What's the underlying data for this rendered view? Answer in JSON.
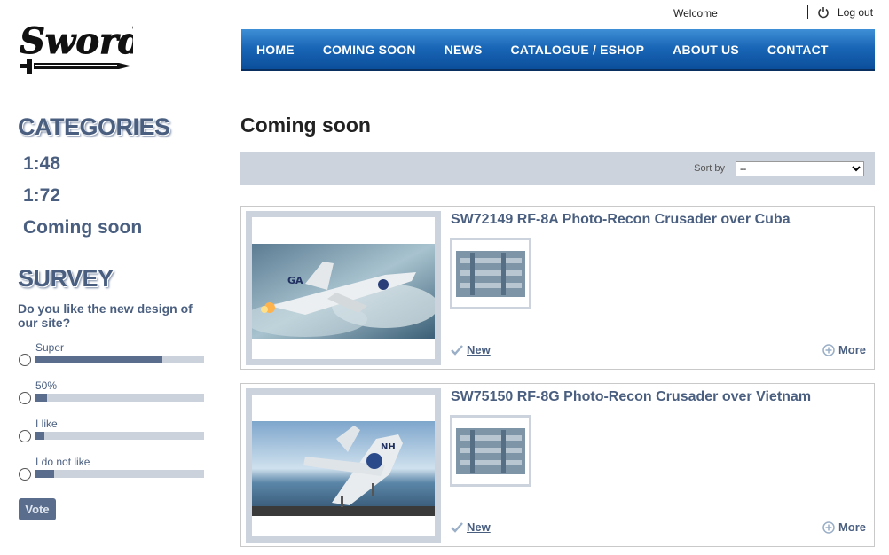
{
  "header": {
    "logo_icon": "sword-logo",
    "welcome": "Welcome",
    "logout": "Log out",
    "logout_icon": "power-icon"
  },
  "nav": {
    "items": [
      {
        "label": "HOME"
      },
      {
        "label": "COMING SOON"
      },
      {
        "label": "NEWS"
      },
      {
        "label": "CATALOGUE / ESHOP"
      },
      {
        "label": "ABOUT US"
      },
      {
        "label": "CONTACT"
      }
    ],
    "colors": {
      "top": "#3e8fd6",
      "bottom": "#0b4f9b"
    }
  },
  "sidebar": {
    "categories_heading": "CATEGORIES",
    "categories": [
      {
        "label": "1:48"
      },
      {
        "label": "1:72"
      },
      {
        "label": "Coming soon"
      }
    ],
    "survey_heading": "SURVEY",
    "survey_question": "Do you like the new design of our site?",
    "options": [
      {
        "label": "Super",
        "fraction": 0.75
      },
      {
        "label": "50%",
        "fraction": 0.07
      },
      {
        "label": "I like",
        "fraction": 0.05
      },
      {
        "label": "I do not like",
        "fraction": 0.11
      }
    ],
    "vote_label": "Vote"
  },
  "main": {
    "title": "Coming soon",
    "sort_label": "Sort by",
    "sort_value": "--",
    "products": [
      {
        "title": "SW72149 RF-8A Photo-Recon Crusader over Cuba",
        "new_label": "New",
        "more_label": "More"
      },
      {
        "title": "SW75150 RF-8G Photo-Recon Crusader over Vietnam",
        "new_label": "New",
        "more_label": "More"
      }
    ]
  },
  "colors": {
    "accent": "#4a5f80",
    "bar": "#cdd3dc"
  }
}
